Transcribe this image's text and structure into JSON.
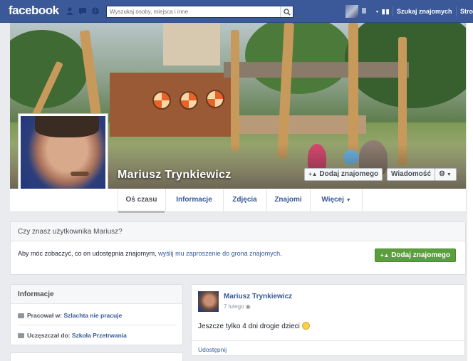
{
  "topbar": {
    "logo": "facebook",
    "search_placeholder": "Wyszukaj osoby, miejsca i inne",
    "bars": "▪ ▮▮",
    "find_friends": "Szukaj znajomych",
    "home_truncated": "Stro"
  },
  "profile": {
    "name": "Mariusz Trynkiewicz",
    "add_friend": "Dodaj znajomego",
    "message": "Wiadomość",
    "settings_icon": "gear-icon"
  },
  "tabs": [
    {
      "label": "Oś czasu",
      "active": true
    },
    {
      "label": "Informacje"
    },
    {
      "label": "Zdjęcia"
    },
    {
      "label": "Znajomi"
    },
    {
      "label": "Więcej"
    }
  ],
  "know": {
    "title": "Czy znasz użytkownika Mariusz?",
    "text_before": "Aby móc zobaczyć, co on udostępnia znajomym, ",
    "link": "wyślij mu zaproszenie do grona znajomych",
    "text_after": ".",
    "button": "Dodaj znajomego"
  },
  "info": {
    "title": "Informacje",
    "work_prefix": "Pracował w:",
    "work_place": "Szlachta nie pracuje",
    "school_prefix": "Uczęszczał do:",
    "school_place": "Szkoła Przetrwania"
  },
  "post": {
    "author": "Mariusz Trynkiewicz",
    "time": "7 lutego",
    "text": "Jeszcze tylko 4 dni drogie dzieci",
    "share": "Udostępnij"
  },
  "colors": {
    "brand": "#3b5998",
    "link": "#365899",
    "green": "#5b9f3d"
  }
}
